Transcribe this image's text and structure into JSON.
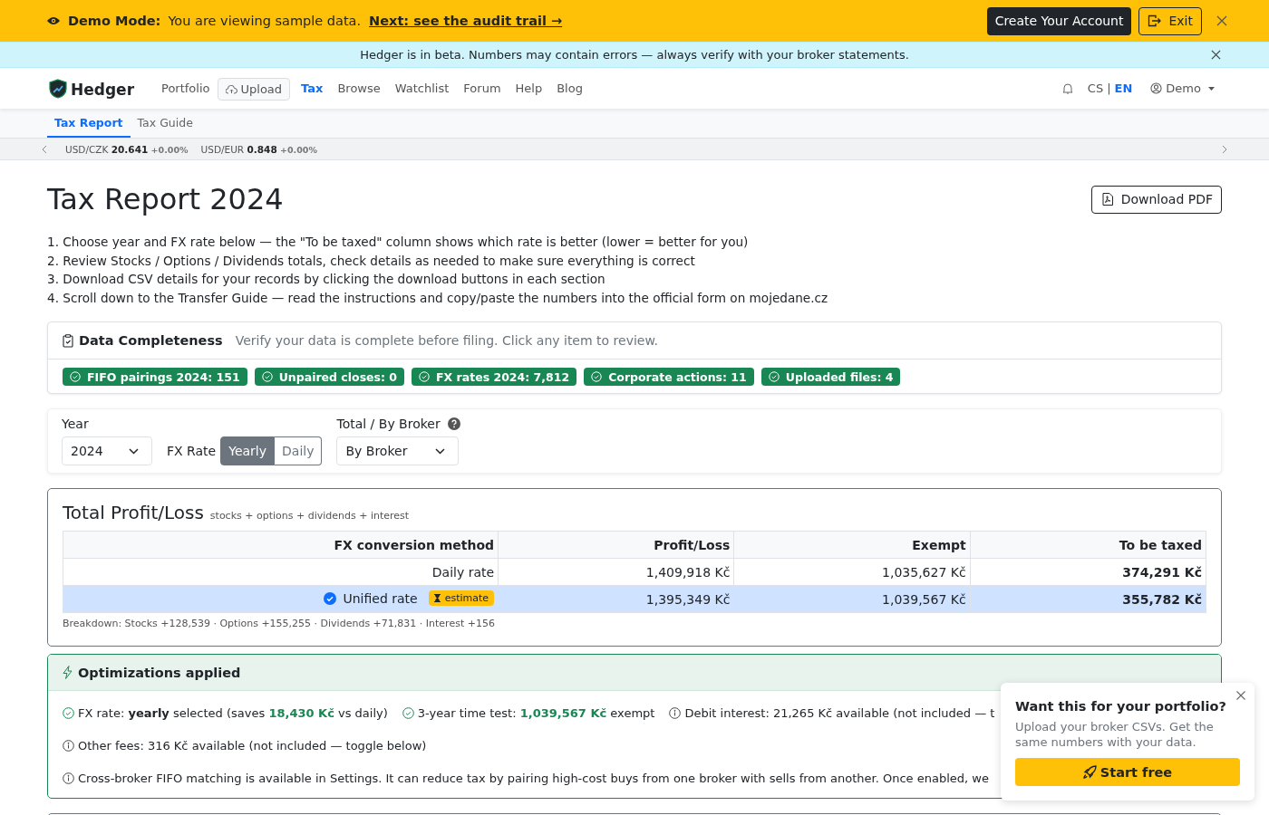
{
  "demo_banner": {
    "label": "Demo Mode:",
    "text": "You are viewing sample data.",
    "link": "Next: see the audit trail →",
    "create_button": "Create Your Account",
    "exit_button": "Exit"
  },
  "beta_banner": {
    "text": "Hedger is in beta. Numbers may contain errors — always verify with your broker statements."
  },
  "navbar": {
    "brand": "Hedger",
    "items": [
      {
        "label": "Portfolio",
        "kind": "link",
        "selected": false
      },
      {
        "label": "Upload",
        "kind": "button",
        "selected": false
      },
      {
        "label": "Tax",
        "kind": "link",
        "selected": true
      },
      {
        "label": "Browse",
        "kind": "link",
        "selected": false
      },
      {
        "label": "Watchlist",
        "kind": "link",
        "selected": false
      },
      {
        "label": "Forum",
        "kind": "link",
        "selected": false
      },
      {
        "label": "Help",
        "kind": "link",
        "selected": false
      },
      {
        "label": "Blog",
        "kind": "link",
        "selected": false
      }
    ],
    "languages": [
      {
        "label": "CS",
        "selected": false
      },
      {
        "label": "EN",
        "selected": true
      }
    ],
    "language_separator": "|",
    "user": "Demo"
  },
  "subnav": {
    "tabs": [
      {
        "label": "Tax Report",
        "selected": true
      },
      {
        "label": "Tax Guide",
        "selected": false
      }
    ]
  },
  "ticker": [
    {
      "pair": "USD/CZK",
      "value": "20.641",
      "change": "+0.00%"
    },
    {
      "pair": "USD/EUR",
      "value": "0.848",
      "change": "+0.00%"
    }
  ],
  "page": {
    "title": "Tax Report 2024",
    "download_button": "Download PDF",
    "instructions": [
      "1. Choose year and FX rate below — the \"To be taxed\" column shows which rate is better (lower = better for you)",
      "2. Review Stocks / Options / Dividends totals, check details as needed to make sure everything is correct",
      "3. Download CSV details for your records by clicking the download buttons in each section",
      "4. Scroll down to the Transfer Guide — read the instructions and copy/paste the numbers into the official form on mojedane.cz"
    ]
  },
  "completeness": {
    "title": "Data Completeness",
    "hint": "Verify your data is complete before filing. Click any item to review.",
    "badges": [
      "FIFO pairings 2024: 151",
      "Unpaired closes: 0",
      "FX rates 2024: 7,812",
      "Corporate actions: 11",
      "Uploaded files: 4"
    ]
  },
  "controls": {
    "year_label": "Year",
    "year": "2024",
    "fx_label": "FX Rate",
    "fx_options": [
      {
        "label": "Yearly",
        "selected": true
      },
      {
        "label": "Daily",
        "selected": false
      }
    ],
    "broker_label": "Total / By Broker",
    "broker": "By Broker"
  },
  "profit_loss": {
    "title": "Total Profit/Loss",
    "subtitle": "stocks + options + dividends + interest",
    "columns": [
      "FX conversion method",
      "Profit/Loss",
      "Exempt",
      "To be taxed"
    ],
    "rows": [
      {
        "method": "Daily rate",
        "selected": false,
        "profit": "1,409,918 Kč",
        "exempt": "1,035,627 Kč",
        "taxed": "374,291 Kč"
      },
      {
        "method": "Unified rate",
        "selected": true,
        "badge": "estimate",
        "profit": "1,395,349 Kč",
        "exempt": "1,039,567 Kč",
        "taxed": "355,782 Kč"
      }
    ],
    "breakdown": "Breakdown: Stocks +128,539 · Options +155,255 · Dividends +71,831 · Interest +156"
  },
  "optimizations": {
    "title": "Optimizations applied",
    "lines": [
      [
        {
          "kind": "check",
          "parts": [
            {
              "kind": "plain",
              "text": "FX rate: "
            },
            {
              "kind": "bold",
              "text": "yearly"
            },
            {
              "kind": "plain",
              "text": " selected (saves "
            },
            {
              "kind": "value",
              "text": "18,430 Kč"
            },
            {
              "kind": "plain",
              "text": " vs daily)"
            }
          ]
        },
        {
          "kind": "check",
          "parts": [
            {
              "kind": "plain",
              "text": "3-year time test: "
            },
            {
              "kind": "value",
              "text": "1,039,567 Kč"
            },
            {
              "kind": "plain",
              "text": " exempt"
            }
          ]
        },
        {
          "kind": "info",
          "parts": [
            {
              "kind": "plain",
              "text": "Debit interest: 21,265 Kč available (not included — t"
            }
          ]
        }
      ],
      [
        {
          "kind": "info",
          "parts": [
            {
              "kind": "plain",
              "text": "Other fees: 316 Kč available (not included — toggle below)"
            }
          ]
        }
      ],
      [
        {
          "kind": "info",
          "parts": [
            {
              "kind": "plain",
              "text": "Cross-broker FIFO matching is available in Settings. It can reduce tax by pairing high-cost buys from one broker with sells from another. Once enabled, we"
            }
          ]
        }
      ]
    ]
  },
  "popup": {
    "title": "Want this for your portfolio?",
    "text": "Upload your broker CSVs. Get the same numbers with your data.",
    "button": "Start free"
  }
}
